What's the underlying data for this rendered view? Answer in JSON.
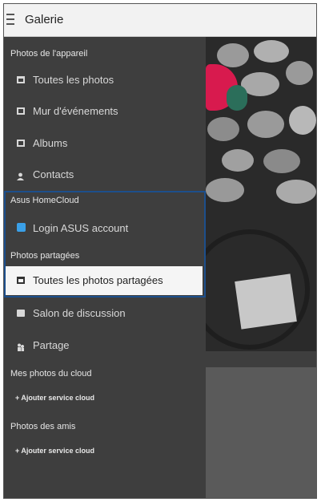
{
  "app_bar": {
    "title": "Galerie",
    "menu_icon": "hamburger-menu-icon"
  },
  "drawer": {
    "sections": [
      {
        "id": "device",
        "label": "Photos de l'appareil"
      },
      {
        "id": "homecloud",
        "label": "Asus HomeCloud"
      },
      {
        "id": "shared",
        "label": "Photos partagées"
      },
      {
        "id": "cloud",
        "label": "Mes photos du cloud"
      },
      {
        "id": "friends",
        "label": "Photos des amis"
      }
    ],
    "items": [
      {
        "label": "Toutes les photos",
        "icon": "photos-icon"
      },
      {
        "label": "Mur d'événements",
        "icon": "event-wall-icon"
      },
      {
        "label": "Albums",
        "icon": "albums-icon"
      },
      {
        "label": "Contacts",
        "icon": "contacts-icon"
      },
      {
        "label": "Login ASUS account",
        "icon": "asus-homecloud-icon"
      },
      {
        "label": "Toutes les photos partagées",
        "icon": "shared-photos-icon",
        "selected": true
      },
      {
        "label": "Salon de discussion",
        "icon": "chat-icon"
      },
      {
        "label": "Partage",
        "icon": "share-icon"
      }
    ],
    "cloud_add_label": "+ Ajouter service cloud",
    "friends_add_label": "+ Ajouter service cloud"
  },
  "colors": {
    "drawer_bg": "#3e3e3e",
    "app_bar_bg": "#f2f2f2",
    "selected_bg": "#f5f5f5",
    "highlight_border": "#1d4f8c",
    "homecloud_icon": "#3aa0e8"
  }
}
